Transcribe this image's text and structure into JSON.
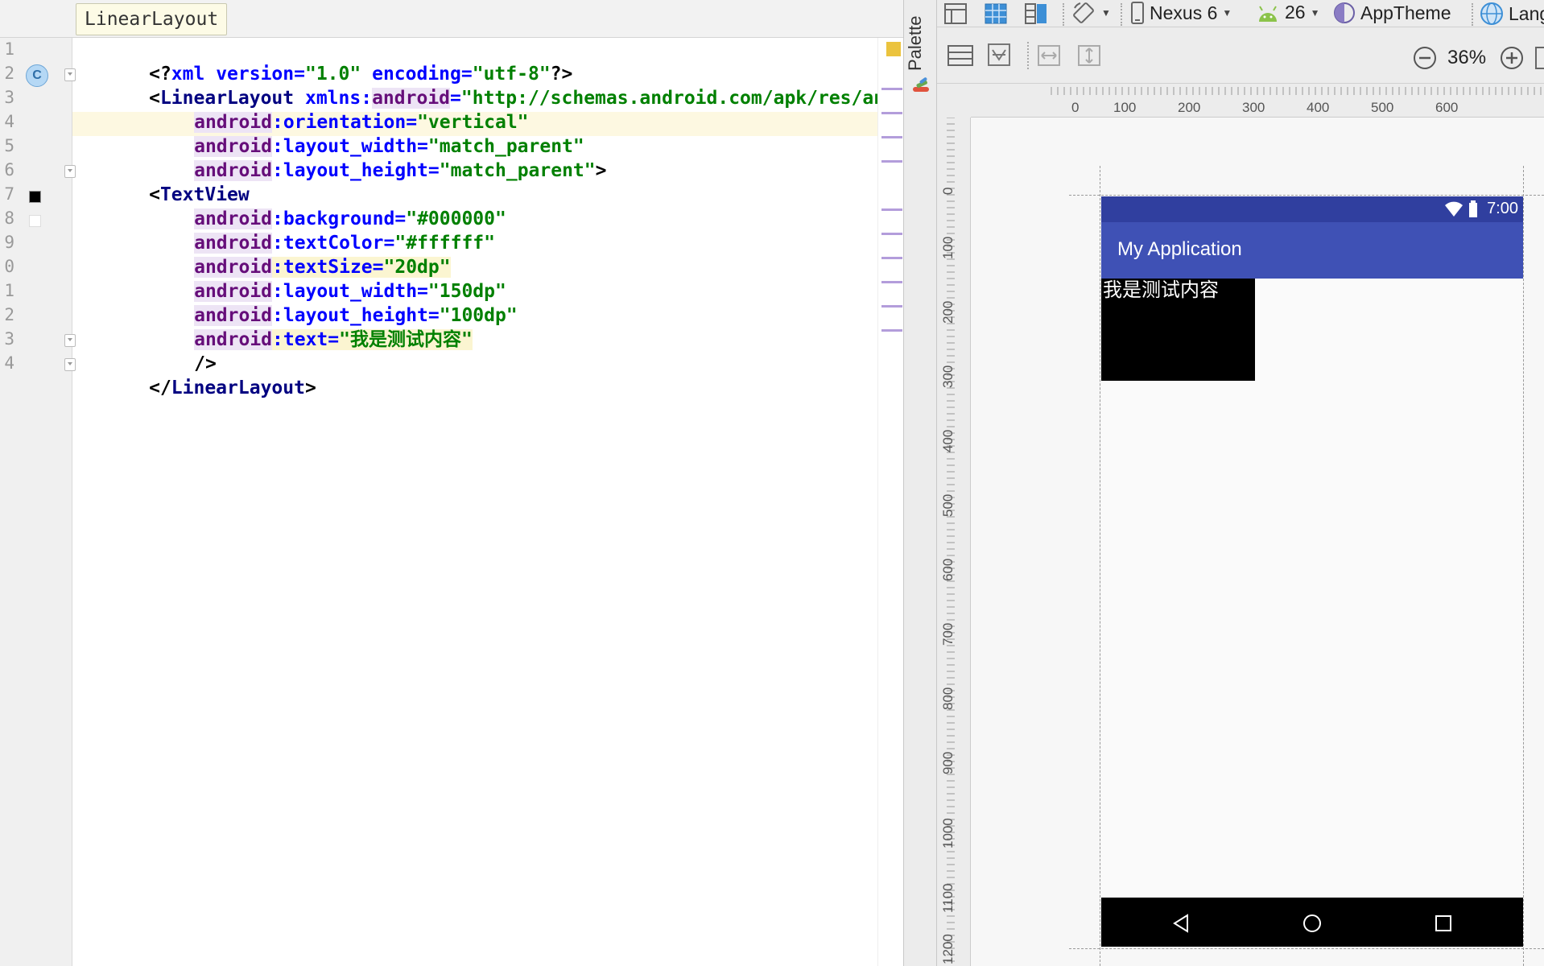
{
  "editor": {
    "breadcrumb": "LinearLayout",
    "line_numbers": [
      "1",
      "2",
      "3",
      "4",
      "5",
      "6",
      "7",
      "8",
      "9",
      "0",
      "1",
      "2",
      "3",
      "4"
    ],
    "gutter_marker": "C",
    "lines": {
      "l1": {
        "a": "<?",
        "b": "xml ",
        "c": "version",
        "d": "=",
        "e": "\"1.0\"",
        "f": " ",
        "g": "encoding",
        "h": "=",
        "i": "\"utf-8\"",
        "j": "?>"
      },
      "l2": {
        "a": "<",
        "b": "LinearLayout",
        "c": " ",
        "d": "xmlns:",
        "e": "android",
        "f": "=",
        "g": "\"http://schemas.android.com/apk/res/android\""
      },
      "l3": {
        "ns": "android",
        "attr": ":orientation",
        "eq": "=",
        "val": "\"vertical\""
      },
      "l4": {
        "ns": "android",
        "attr": ":layout_width",
        "eq": "=",
        "val": "\"match_parent\""
      },
      "l5": {
        "ns": "android",
        "attr": ":layout_height",
        "eq": "=",
        "val": "\"match_parent\"",
        "end": ">"
      },
      "l6": {
        "a": "<",
        "b": "TextView"
      },
      "l7": {
        "ns": "android",
        "attr": ":background",
        "eq": "=",
        "val": "\"#000000\""
      },
      "l8": {
        "ns": "android",
        "attr": ":textColor",
        "eq": "=",
        "val": "\"#ffffff\""
      },
      "l9": {
        "ns": "android",
        "attr": ":textSize",
        "eq": "=",
        "val": "\"20dp\""
      },
      "l10": {
        "ns": "android",
        "attr": ":layout_width",
        "eq": "=",
        "val": "\"150dp\""
      },
      "l11": {
        "ns": "android",
        "attr": ":layout_height",
        "eq": "=",
        "val": "\"100dp\""
      },
      "l12": {
        "ns": "android",
        "attr": ":text",
        "eq": "=",
        "val": "\"我是测试内容\""
      },
      "l13": {
        "a": "/>"
      },
      "l14": {
        "a": "</",
        "b": "LinearLayout",
        "c": ">"
      }
    },
    "swatches": {
      "line7": "#000000",
      "line8": "#ffffff"
    }
  },
  "palette": {
    "label": "Palette"
  },
  "design": {
    "toolbar": {
      "device": "Nexus 6",
      "api": "26",
      "theme": "AppTheme",
      "language": "Lang",
      "zoom": "36%"
    },
    "ruler_top": [
      "0",
      "100",
      "200",
      "300",
      "400",
      "500",
      "600"
    ],
    "ruler_left": [
      "0",
      "100",
      "200",
      "300",
      "400",
      "500",
      "600",
      "700",
      "800",
      "900",
      "1000",
      "1100",
      "1200"
    ],
    "preview": {
      "time": "7:00",
      "app_title": "My Application",
      "text_view": "我是测试内容"
    }
  },
  "colors": {
    "status_bar": "#303f9f",
    "app_bar": "#3f51b5",
    "namespace": "#660e7a",
    "attribute": "#0000ff",
    "string": "#008000",
    "tag": "#000080"
  }
}
